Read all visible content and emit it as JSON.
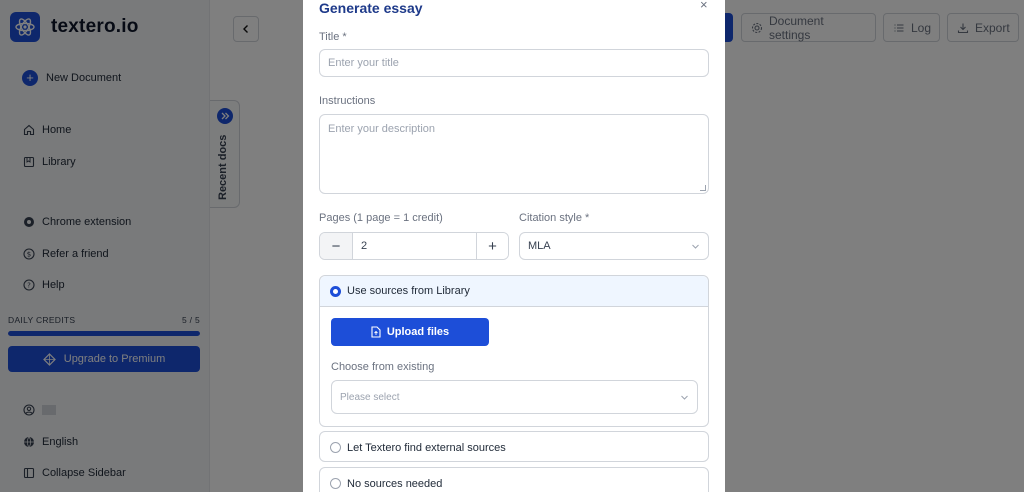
{
  "app": {
    "logo_text": "textero.io"
  },
  "sidebar": {
    "new_document": "New Document",
    "items": [
      {
        "label": "Home",
        "icon": "home-icon"
      },
      {
        "label": "Library",
        "icon": "library-icon"
      },
      {
        "label": "Chrome extension",
        "icon": "chrome-icon"
      },
      {
        "label": "Refer a friend",
        "icon": "dollar-icon"
      },
      {
        "label": "Help",
        "icon": "help-icon"
      }
    ],
    "credits": {
      "label": "DAILY CREDITS",
      "count": "5 / 5",
      "fraction": 1.0
    },
    "upgrade": "Upgrade to Premium",
    "footer": [
      {
        "label": "",
        "icon": "user-icon"
      },
      {
        "label": "English",
        "icon": "globe-icon"
      },
      {
        "label": "Collapse Sidebar",
        "icon": "collapse-icon"
      }
    ]
  },
  "main": {
    "recent_docs": "Recent docs",
    "toolbar": {
      "document_settings": "Document settings",
      "log": "Log",
      "export": "Export"
    }
  },
  "modal": {
    "title": "Generate essay",
    "title_field": {
      "label": "Title *",
      "placeholder": "Enter your title"
    },
    "instructions": {
      "label": "Instructions",
      "placeholder": "Enter your description"
    },
    "pages": {
      "label": "Pages (1 page = 1 credit)",
      "value": "2",
      "minus": "−",
      "plus": "+"
    },
    "citation": {
      "label": "Citation style *",
      "value": "MLA"
    },
    "sources": {
      "library": "Use sources from Library",
      "upload": "Upload files",
      "choose_label": "Choose from existing",
      "choose_placeholder": "Please select",
      "external": "Let Textero find external sources",
      "none": "No sources needed"
    }
  },
  "colors": {
    "accent": "#1d4ed8",
    "title": "#1e3a8a"
  }
}
